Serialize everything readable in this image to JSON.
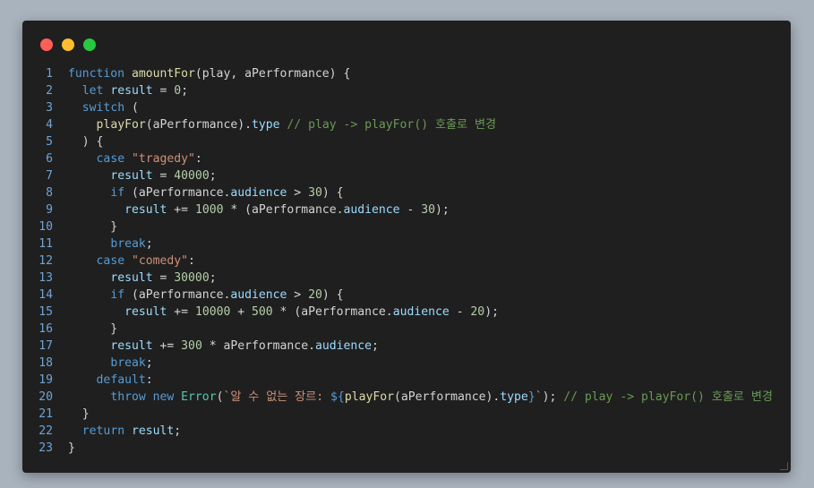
{
  "window": {
    "controls": [
      {
        "name": "close",
        "color": "#ff5f57"
      },
      {
        "name": "minimize",
        "color": "#febc2e"
      },
      {
        "name": "maximize",
        "color": "#28c840"
      }
    ]
  },
  "theme": {
    "background": "#1f1f1f",
    "keyword": "#569cd6",
    "function": "#dcdcaa",
    "string": "#ce9178",
    "number": "#b5cea8",
    "comment": "#6a9955",
    "line_number": "#6fa4d6"
  },
  "code": {
    "lines": [
      {
        "n": "1",
        "tokens": [
          {
            "t": "kw",
            "v": "function "
          },
          {
            "t": "fn",
            "v": "amountFor"
          },
          {
            "t": "tx",
            "v": "(play, aPerformance) {"
          }
        ]
      },
      {
        "n": "2",
        "tokens": [
          {
            "t": "tx",
            "v": "  "
          },
          {
            "t": "kw",
            "v": "let "
          },
          {
            "t": "pr",
            "v": "result"
          },
          {
            "t": "tx",
            "v": " = "
          },
          {
            "t": "num",
            "v": "0"
          },
          {
            "t": "tx",
            "v": ";"
          }
        ]
      },
      {
        "n": "3",
        "tokens": [
          {
            "t": "tx",
            "v": "  "
          },
          {
            "t": "kw",
            "v": "switch"
          },
          {
            "t": "tx",
            "v": " ("
          }
        ]
      },
      {
        "n": "4",
        "tokens": [
          {
            "t": "tx",
            "v": "    "
          },
          {
            "t": "fn",
            "v": "playFor"
          },
          {
            "t": "tx",
            "v": "(aPerformance)."
          },
          {
            "t": "pr",
            "v": "type"
          },
          {
            "t": "tx",
            "v": " "
          },
          {
            "t": "cm",
            "v": "// play -> playFor() 호출로 변경"
          }
        ]
      },
      {
        "n": "5",
        "tokens": [
          {
            "t": "tx",
            "v": "  ) {"
          }
        ]
      },
      {
        "n": "6",
        "tokens": [
          {
            "t": "tx",
            "v": "    "
          },
          {
            "t": "kw",
            "v": "case "
          },
          {
            "t": "str",
            "v": "\"tragedy\""
          },
          {
            "t": "tx",
            "v": ":"
          }
        ]
      },
      {
        "n": "7",
        "tokens": [
          {
            "t": "tx",
            "v": "      "
          },
          {
            "t": "pr",
            "v": "result"
          },
          {
            "t": "tx",
            "v": " = "
          },
          {
            "t": "num",
            "v": "40000"
          },
          {
            "t": "tx",
            "v": ";"
          }
        ]
      },
      {
        "n": "8",
        "tokens": [
          {
            "t": "tx",
            "v": "      "
          },
          {
            "t": "kw",
            "v": "if"
          },
          {
            "t": "tx",
            "v": " (aPerformance."
          },
          {
            "t": "pr",
            "v": "audience"
          },
          {
            "t": "tx",
            "v": " > "
          },
          {
            "t": "num",
            "v": "30"
          },
          {
            "t": "tx",
            "v": ") {"
          }
        ]
      },
      {
        "n": "9",
        "tokens": [
          {
            "t": "tx",
            "v": "        "
          },
          {
            "t": "pr",
            "v": "result"
          },
          {
            "t": "tx",
            "v": " += "
          },
          {
            "t": "num",
            "v": "1000"
          },
          {
            "t": "tx",
            "v": " * (aPerformance."
          },
          {
            "t": "pr",
            "v": "audience"
          },
          {
            "t": "tx",
            "v": " - "
          },
          {
            "t": "num",
            "v": "30"
          },
          {
            "t": "tx",
            "v": ");"
          }
        ]
      },
      {
        "n": "10",
        "tokens": [
          {
            "t": "tx",
            "v": "      }"
          }
        ]
      },
      {
        "n": "11",
        "tokens": [
          {
            "t": "tx",
            "v": "      "
          },
          {
            "t": "kw",
            "v": "break"
          },
          {
            "t": "tx",
            "v": ";"
          }
        ]
      },
      {
        "n": "12",
        "tokens": [
          {
            "t": "tx",
            "v": "    "
          },
          {
            "t": "kw",
            "v": "case "
          },
          {
            "t": "str",
            "v": "\"comedy\""
          },
          {
            "t": "tx",
            "v": ":"
          }
        ]
      },
      {
        "n": "13",
        "tokens": [
          {
            "t": "tx",
            "v": "      "
          },
          {
            "t": "pr",
            "v": "result"
          },
          {
            "t": "tx",
            "v": " = "
          },
          {
            "t": "num",
            "v": "30000"
          },
          {
            "t": "tx",
            "v": ";"
          }
        ]
      },
      {
        "n": "14",
        "tokens": [
          {
            "t": "tx",
            "v": "      "
          },
          {
            "t": "kw",
            "v": "if"
          },
          {
            "t": "tx",
            "v": " (aPerformance."
          },
          {
            "t": "pr",
            "v": "audience"
          },
          {
            "t": "tx",
            "v": " > "
          },
          {
            "t": "num",
            "v": "20"
          },
          {
            "t": "tx",
            "v": ") {"
          }
        ]
      },
      {
        "n": "15",
        "tokens": [
          {
            "t": "tx",
            "v": "        "
          },
          {
            "t": "pr",
            "v": "result"
          },
          {
            "t": "tx",
            "v": " += "
          },
          {
            "t": "num",
            "v": "10000"
          },
          {
            "t": "tx",
            "v": " + "
          },
          {
            "t": "num",
            "v": "500"
          },
          {
            "t": "tx",
            "v": " * (aPerformance."
          },
          {
            "t": "pr",
            "v": "audience"
          },
          {
            "t": "tx",
            "v": " - "
          },
          {
            "t": "num",
            "v": "20"
          },
          {
            "t": "tx",
            "v": ");"
          }
        ]
      },
      {
        "n": "16",
        "tokens": [
          {
            "t": "tx",
            "v": "      }"
          }
        ]
      },
      {
        "n": "17",
        "tokens": [
          {
            "t": "tx",
            "v": "      "
          },
          {
            "t": "pr",
            "v": "result"
          },
          {
            "t": "tx",
            "v": " += "
          },
          {
            "t": "num",
            "v": "300"
          },
          {
            "t": "tx",
            "v": " * aPerformance."
          },
          {
            "t": "pr",
            "v": "audience"
          },
          {
            "t": "tx",
            "v": ";"
          }
        ]
      },
      {
        "n": "18",
        "tokens": [
          {
            "t": "tx",
            "v": "      "
          },
          {
            "t": "kw",
            "v": "break"
          },
          {
            "t": "tx",
            "v": ";"
          }
        ]
      },
      {
        "n": "19",
        "tokens": [
          {
            "t": "tx",
            "v": "    "
          },
          {
            "t": "kw",
            "v": "default"
          },
          {
            "t": "tx",
            "v": ":"
          }
        ]
      },
      {
        "n": "20",
        "tokens": [
          {
            "t": "tx",
            "v": "      "
          },
          {
            "t": "kw",
            "v": "throw new "
          },
          {
            "t": "ty",
            "v": "Error"
          },
          {
            "t": "tx",
            "v": "("
          },
          {
            "t": "str",
            "v": "`알 수 없는 장르: "
          },
          {
            "t": "kw",
            "v": "${"
          },
          {
            "t": "fn",
            "v": "playFor"
          },
          {
            "t": "tx",
            "v": "(aPerformance)."
          },
          {
            "t": "pr",
            "v": "type"
          },
          {
            "t": "kw",
            "v": "}"
          },
          {
            "t": "str",
            "v": "`"
          },
          {
            "t": "tx",
            "v": "); "
          },
          {
            "t": "cm",
            "v": "// play -> playFor() 호출로 변경"
          }
        ]
      },
      {
        "n": "21",
        "tokens": [
          {
            "t": "tx",
            "v": "  }"
          }
        ]
      },
      {
        "n": "22",
        "tokens": [
          {
            "t": "tx",
            "v": "  "
          },
          {
            "t": "kw",
            "v": "return "
          },
          {
            "t": "pr",
            "v": "result"
          },
          {
            "t": "tx",
            "v": ";"
          }
        ]
      },
      {
        "n": "23",
        "tokens": [
          {
            "t": "tx",
            "v": "}"
          }
        ]
      }
    ]
  }
}
